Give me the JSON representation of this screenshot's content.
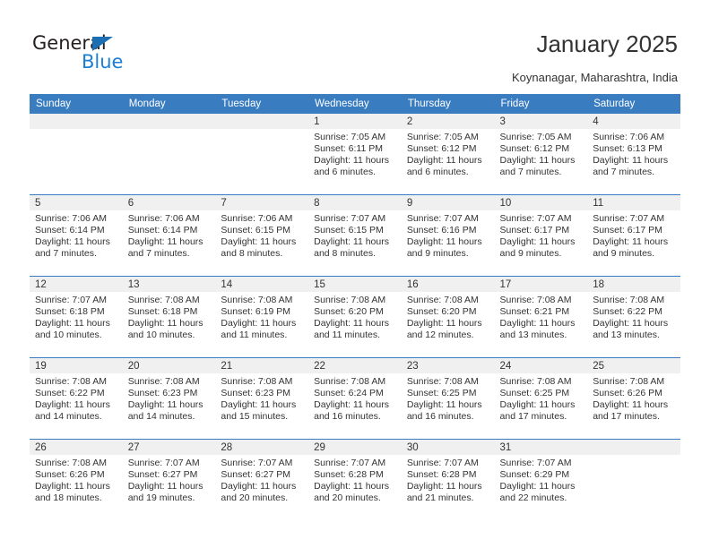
{
  "brand": {
    "name_part1": "General",
    "name_part2": "Blue",
    "triangle_icon": "triangle-icon",
    "accent_color": "#1c7fd4"
  },
  "header": {
    "title": "January 2025",
    "location": "Koynanagar, Maharashtra, India"
  },
  "colors": {
    "header_blue": "#3a7cc0",
    "date_strip_gray": "#f0f0f0",
    "text": "#333333"
  },
  "weekdays": [
    "Sunday",
    "Monday",
    "Tuesday",
    "Wednesday",
    "Thursday",
    "Friday",
    "Saturday"
  ],
  "weeks": [
    [
      {
        "day": "",
        "empty": true,
        "sunrise": "",
        "sunset": "",
        "daylight_line1": "",
        "daylight_line2": ""
      },
      {
        "day": "",
        "empty": true,
        "sunrise": "",
        "sunset": "",
        "daylight_line1": "",
        "daylight_line2": ""
      },
      {
        "day": "",
        "empty": true,
        "sunrise": "",
        "sunset": "",
        "daylight_line1": "",
        "daylight_line2": ""
      },
      {
        "day": "1",
        "empty": false,
        "sunrise": "Sunrise: 7:05 AM",
        "sunset": "Sunset: 6:11 PM",
        "daylight_line1": "Daylight: 11 hours",
        "daylight_line2": "and 6 minutes."
      },
      {
        "day": "2",
        "empty": false,
        "sunrise": "Sunrise: 7:05 AM",
        "sunset": "Sunset: 6:12 PM",
        "daylight_line1": "Daylight: 11 hours",
        "daylight_line2": "and 6 minutes."
      },
      {
        "day": "3",
        "empty": false,
        "sunrise": "Sunrise: 7:05 AM",
        "sunset": "Sunset: 6:12 PM",
        "daylight_line1": "Daylight: 11 hours",
        "daylight_line2": "and 7 minutes."
      },
      {
        "day": "4",
        "empty": false,
        "sunrise": "Sunrise: 7:06 AM",
        "sunset": "Sunset: 6:13 PM",
        "daylight_line1": "Daylight: 11 hours",
        "daylight_line2": "and 7 minutes."
      }
    ],
    [
      {
        "day": "5",
        "empty": false,
        "sunrise": "Sunrise: 7:06 AM",
        "sunset": "Sunset: 6:14 PM",
        "daylight_line1": "Daylight: 11 hours",
        "daylight_line2": "and 7 minutes."
      },
      {
        "day": "6",
        "empty": false,
        "sunrise": "Sunrise: 7:06 AM",
        "sunset": "Sunset: 6:14 PM",
        "daylight_line1": "Daylight: 11 hours",
        "daylight_line2": "and 7 minutes."
      },
      {
        "day": "7",
        "empty": false,
        "sunrise": "Sunrise: 7:06 AM",
        "sunset": "Sunset: 6:15 PM",
        "daylight_line1": "Daylight: 11 hours",
        "daylight_line2": "and 8 minutes."
      },
      {
        "day": "8",
        "empty": false,
        "sunrise": "Sunrise: 7:07 AM",
        "sunset": "Sunset: 6:15 PM",
        "daylight_line1": "Daylight: 11 hours",
        "daylight_line2": "and 8 minutes."
      },
      {
        "day": "9",
        "empty": false,
        "sunrise": "Sunrise: 7:07 AM",
        "sunset": "Sunset: 6:16 PM",
        "daylight_line1": "Daylight: 11 hours",
        "daylight_line2": "and 9 minutes."
      },
      {
        "day": "10",
        "empty": false,
        "sunrise": "Sunrise: 7:07 AM",
        "sunset": "Sunset: 6:17 PM",
        "daylight_line1": "Daylight: 11 hours",
        "daylight_line2": "and 9 minutes."
      },
      {
        "day": "11",
        "empty": false,
        "sunrise": "Sunrise: 7:07 AM",
        "sunset": "Sunset: 6:17 PM",
        "daylight_line1": "Daylight: 11 hours",
        "daylight_line2": "and 9 minutes."
      }
    ],
    [
      {
        "day": "12",
        "empty": false,
        "sunrise": "Sunrise: 7:07 AM",
        "sunset": "Sunset: 6:18 PM",
        "daylight_line1": "Daylight: 11 hours",
        "daylight_line2": "and 10 minutes."
      },
      {
        "day": "13",
        "empty": false,
        "sunrise": "Sunrise: 7:08 AM",
        "sunset": "Sunset: 6:18 PM",
        "daylight_line1": "Daylight: 11 hours",
        "daylight_line2": "and 10 minutes."
      },
      {
        "day": "14",
        "empty": false,
        "sunrise": "Sunrise: 7:08 AM",
        "sunset": "Sunset: 6:19 PM",
        "daylight_line1": "Daylight: 11 hours",
        "daylight_line2": "and 11 minutes."
      },
      {
        "day": "15",
        "empty": false,
        "sunrise": "Sunrise: 7:08 AM",
        "sunset": "Sunset: 6:20 PM",
        "daylight_line1": "Daylight: 11 hours",
        "daylight_line2": "and 11 minutes."
      },
      {
        "day": "16",
        "empty": false,
        "sunrise": "Sunrise: 7:08 AM",
        "sunset": "Sunset: 6:20 PM",
        "daylight_line1": "Daylight: 11 hours",
        "daylight_line2": "and 12 minutes."
      },
      {
        "day": "17",
        "empty": false,
        "sunrise": "Sunrise: 7:08 AM",
        "sunset": "Sunset: 6:21 PM",
        "daylight_line1": "Daylight: 11 hours",
        "daylight_line2": "and 13 minutes."
      },
      {
        "day": "18",
        "empty": false,
        "sunrise": "Sunrise: 7:08 AM",
        "sunset": "Sunset: 6:22 PM",
        "daylight_line1": "Daylight: 11 hours",
        "daylight_line2": "and 13 minutes."
      }
    ],
    [
      {
        "day": "19",
        "empty": false,
        "sunrise": "Sunrise: 7:08 AM",
        "sunset": "Sunset: 6:22 PM",
        "daylight_line1": "Daylight: 11 hours",
        "daylight_line2": "and 14 minutes."
      },
      {
        "day": "20",
        "empty": false,
        "sunrise": "Sunrise: 7:08 AM",
        "sunset": "Sunset: 6:23 PM",
        "daylight_line1": "Daylight: 11 hours",
        "daylight_line2": "and 14 minutes."
      },
      {
        "day": "21",
        "empty": false,
        "sunrise": "Sunrise: 7:08 AM",
        "sunset": "Sunset: 6:23 PM",
        "daylight_line1": "Daylight: 11 hours",
        "daylight_line2": "and 15 minutes."
      },
      {
        "day": "22",
        "empty": false,
        "sunrise": "Sunrise: 7:08 AM",
        "sunset": "Sunset: 6:24 PM",
        "daylight_line1": "Daylight: 11 hours",
        "daylight_line2": "and 16 minutes."
      },
      {
        "day": "23",
        "empty": false,
        "sunrise": "Sunrise: 7:08 AM",
        "sunset": "Sunset: 6:25 PM",
        "daylight_line1": "Daylight: 11 hours",
        "daylight_line2": "and 16 minutes."
      },
      {
        "day": "24",
        "empty": false,
        "sunrise": "Sunrise: 7:08 AM",
        "sunset": "Sunset: 6:25 PM",
        "daylight_line1": "Daylight: 11 hours",
        "daylight_line2": "and 17 minutes."
      },
      {
        "day": "25",
        "empty": false,
        "sunrise": "Sunrise: 7:08 AM",
        "sunset": "Sunset: 6:26 PM",
        "daylight_line1": "Daylight: 11 hours",
        "daylight_line2": "and 17 minutes."
      }
    ],
    [
      {
        "day": "26",
        "empty": false,
        "sunrise": "Sunrise: 7:08 AM",
        "sunset": "Sunset: 6:26 PM",
        "daylight_line1": "Daylight: 11 hours",
        "daylight_line2": "and 18 minutes."
      },
      {
        "day": "27",
        "empty": false,
        "sunrise": "Sunrise: 7:07 AM",
        "sunset": "Sunset: 6:27 PM",
        "daylight_line1": "Daylight: 11 hours",
        "daylight_line2": "and 19 minutes."
      },
      {
        "day": "28",
        "empty": false,
        "sunrise": "Sunrise: 7:07 AM",
        "sunset": "Sunset: 6:27 PM",
        "daylight_line1": "Daylight: 11 hours",
        "daylight_line2": "and 20 minutes."
      },
      {
        "day": "29",
        "empty": false,
        "sunrise": "Sunrise: 7:07 AM",
        "sunset": "Sunset: 6:28 PM",
        "daylight_line1": "Daylight: 11 hours",
        "daylight_line2": "and 20 minutes."
      },
      {
        "day": "30",
        "empty": false,
        "sunrise": "Sunrise: 7:07 AM",
        "sunset": "Sunset: 6:28 PM",
        "daylight_line1": "Daylight: 11 hours",
        "daylight_line2": "and 21 minutes."
      },
      {
        "day": "31",
        "empty": false,
        "sunrise": "Sunrise: 7:07 AM",
        "sunset": "Sunset: 6:29 PM",
        "daylight_line1": "Daylight: 11 hours",
        "daylight_line2": "and 22 minutes."
      },
      {
        "day": "",
        "empty": true,
        "sunrise": "",
        "sunset": "",
        "daylight_line1": "",
        "daylight_line2": ""
      }
    ]
  ]
}
